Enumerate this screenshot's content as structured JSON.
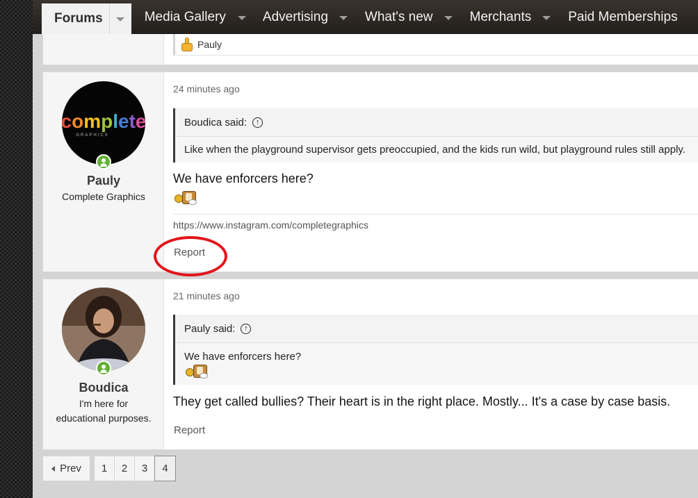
{
  "nav": {
    "active_tab": "Forums",
    "tabs": [
      "Media Gallery",
      "Advertising",
      "What's new",
      "Merchants",
      "Paid Memberships"
    ]
  },
  "prev_post": {
    "liker": "Pauly"
  },
  "posts": [
    {
      "time": "24 minutes ago",
      "username": "Pauly",
      "user_title": "Complete Graphics",
      "avatar_text": "complete",
      "avatar_subtext": "GRAPHICS",
      "quote_author": "Boudica said:",
      "quote_text": "Like when the playground supervisor gets preoccupied, and the kids run wild, but playground rules still apply.",
      "body": "We have enforcers here?",
      "signature": "https://www.instagram.com/completegraphics",
      "report": "Report"
    },
    {
      "time": "21 minutes ago",
      "username": "Boudica",
      "user_title_1": "I'm here for",
      "user_title_2": "educational purposes.",
      "quote_author": "Pauly said:",
      "quote_text": "We have enforcers here?",
      "body": "They get called bullies? Their heart is in the right place. Mostly... It's a case by case basis.",
      "report": "Report"
    }
  ],
  "pagination": {
    "prev": "Prev",
    "pages": [
      "1",
      "2",
      "3",
      "4"
    ],
    "current": "4"
  },
  "colors": {
    "annotation": "#e3141b",
    "online": "#63b134"
  }
}
